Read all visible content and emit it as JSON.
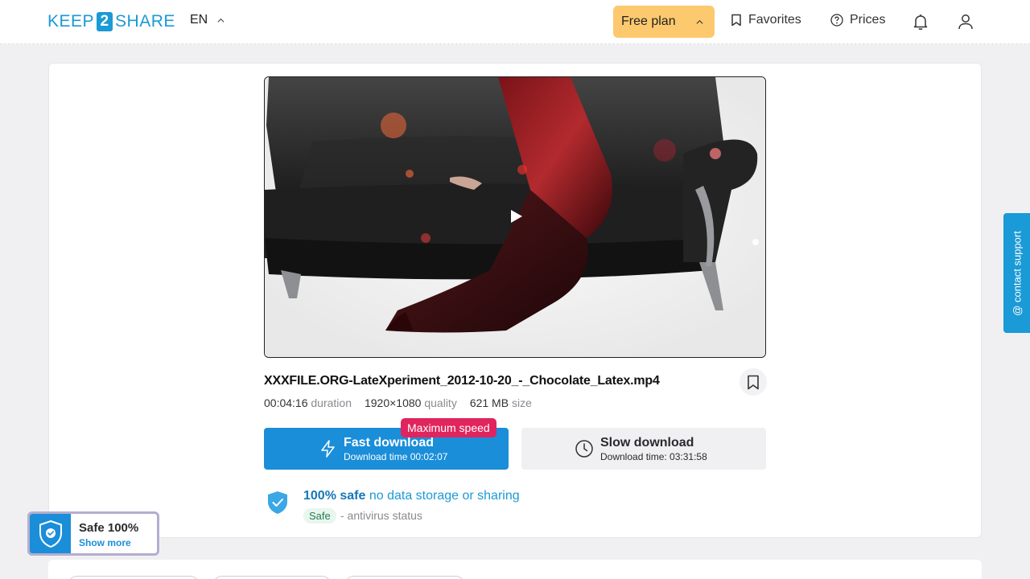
{
  "header": {
    "logo": {
      "left": "KEEP",
      "number": "2",
      "right": "SHARE"
    },
    "language": "EN",
    "plan_label": "Free plan",
    "favorites_label": "Favorites",
    "prices_label": "Prices"
  },
  "file": {
    "name": "XXXFILE.ORG-LateXperiment_2012-10-20_-_Chocolate_Latex.mp4",
    "duration_value": "00:04:16",
    "duration_label": "duration",
    "quality_value": "1920×1080",
    "quality_label": "quality",
    "size_value": "621 MB",
    "size_label": "size"
  },
  "downloads": {
    "badge": "Maximum speed",
    "fast_title": "Fast download",
    "fast_sub": "Download time 00:02:07",
    "slow_title": "Slow download",
    "slow_sub": "Download time: 03:31:58"
  },
  "safety": {
    "title_strong": "100% safe",
    "title_rest": "no data storage or sharing",
    "badge": "Safe",
    "status": "- antivirus status"
  },
  "support_label": "@ contact support",
  "safe_widget": {
    "title": "Safe 100%",
    "link": "Show more"
  },
  "colors": {
    "accent": "#1a9ad6",
    "primary_button": "#1a8ed9",
    "plan_button": "#fcc96e",
    "badge_speed": "#e0245e"
  }
}
